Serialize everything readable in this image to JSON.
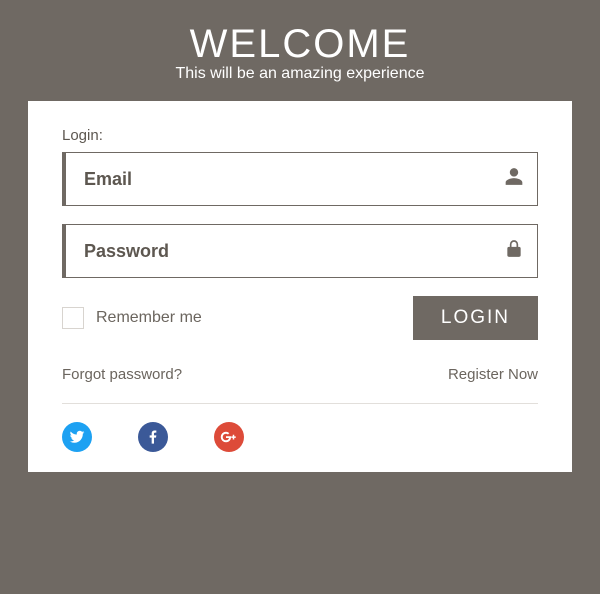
{
  "header": {
    "title": "WELCOME",
    "subtitle": "This will be an amazing experience"
  },
  "form": {
    "label": "Login:",
    "email_placeholder": "Email",
    "password_placeholder": "Password",
    "remember_label": "Remember me",
    "login_button": "LOGIN"
  },
  "links": {
    "forgot": "Forgot password?",
    "register": "Register Now"
  },
  "social": {
    "twitter": "twitter",
    "facebook": "facebook",
    "googleplus": "google-plus"
  },
  "colors": {
    "brand_bg": "#6f6963",
    "twitter": "#1da1f2",
    "facebook": "#3b5998",
    "googleplus": "#dd4b39"
  }
}
